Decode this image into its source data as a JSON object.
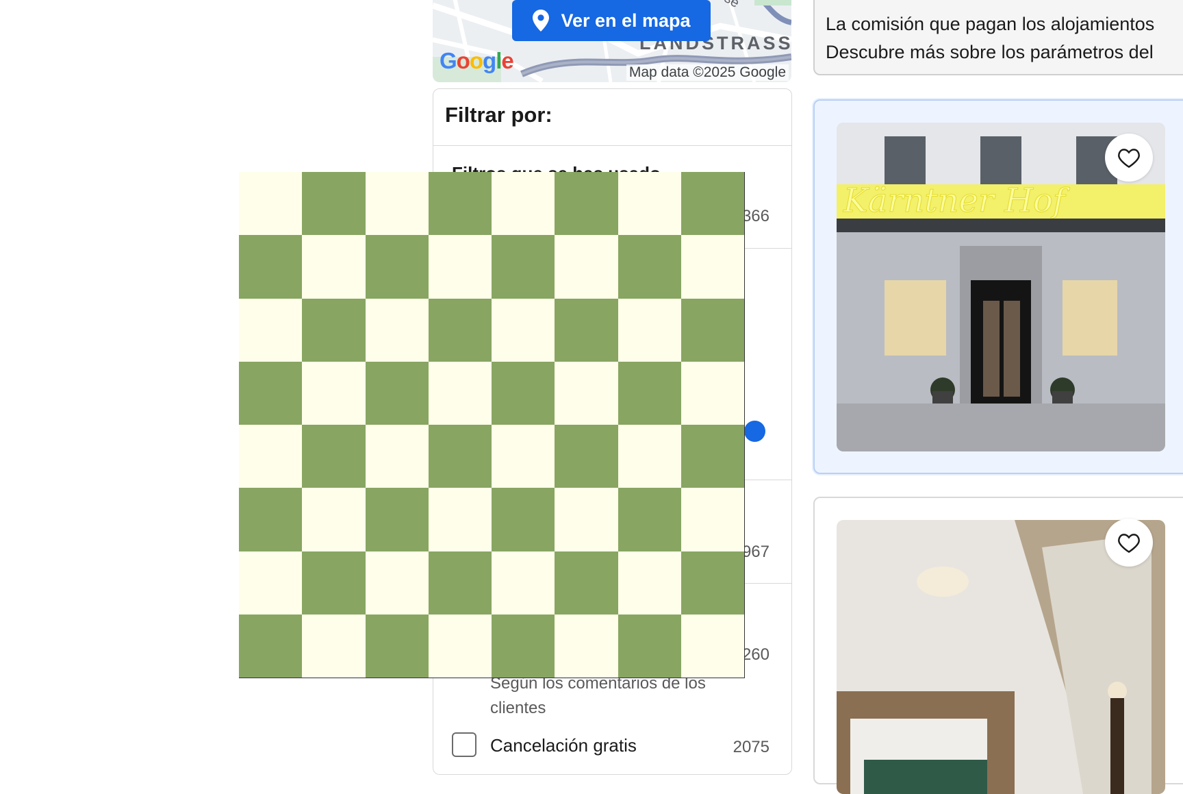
{
  "map": {
    "button_label": "Ver en el mapa",
    "district_label": "LANDSTRASSE",
    "street_fragment": "se",
    "google_logo_letters": [
      "G",
      "o",
      "o",
      "g",
      "l",
      "e"
    ],
    "credit": "Map data ©2025 Google"
  },
  "filters": {
    "title": "Filtrar por:",
    "section_title": "Filtros que se has usado",
    "counts": [
      "366",
      "967",
      "260"
    ],
    "description": "Según los comentarios de los clientes",
    "free_cancellation": {
      "label": "Cancelación gratis",
      "count": "2075",
      "checked": false
    }
  },
  "notice": {
    "line1": "La comisión que pagan los alojamientos",
    "line2": "Descubre más sobre los parámetros del"
  },
  "overlay": {
    "colors": {
      "light": "#fefeea",
      "dark": "#88a562"
    }
  },
  "hotels": [
    {
      "sign_text": "Kärntner Hof",
      "favorite": false
    },
    {
      "favorite": false
    }
  ],
  "colors": {
    "accent": "#1668e3",
    "highlight_bg": "#eef4ff"
  },
  "icons": {
    "pin": "map-pin-icon",
    "heart": "heart-outline-icon"
  }
}
